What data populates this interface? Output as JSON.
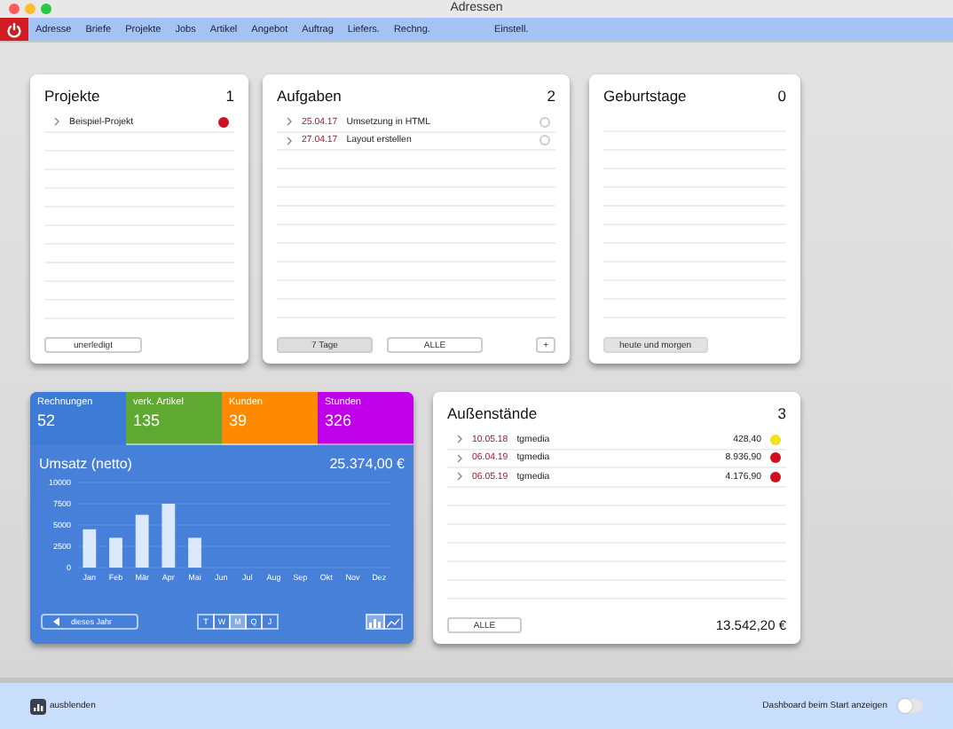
{
  "window": {
    "title": "Adressen"
  },
  "menu": {
    "main": [
      {
        "label": "Adresse"
      },
      {
        "label": "Briefe"
      },
      {
        "label": "Projekte"
      },
      {
        "label": "Jobs"
      },
      {
        "label": "Artikel"
      },
      {
        "label": "Angebot"
      },
      {
        "label": "Auftrag"
      },
      {
        "label": "Liefers."
      },
      {
        "label": "Rechng."
      }
    ],
    "extra": [
      {
        "label": "Einstell."
      }
    ]
  },
  "projects": {
    "title": "Projekte",
    "count": "1",
    "rows": [
      {
        "name": "Beispiel-Projekt",
        "color": "#d0101e"
      }
    ],
    "button": "unerledigt"
  },
  "tasks": {
    "title": "Aufgaben",
    "count": "2",
    "rows": [
      {
        "date": "25.04.17",
        "name": "Umsetzung in HTML",
        "done": false
      },
      {
        "date": "27.04.17",
        "name": "Layout erstellen",
        "done": false
      }
    ],
    "filters": [
      {
        "label": "7 Tage",
        "selected": true
      },
      {
        "label": "ALLE",
        "selected": false
      }
    ],
    "add": "+"
  },
  "birthdays": {
    "title": "Geburtstage",
    "count": "0",
    "button": "heute und morgen"
  },
  "stats": {
    "tabs": [
      {
        "label": "Rechnungen",
        "value": "52",
        "color": "#3e7bd6",
        "selected": true
      },
      {
        "label": "verk. Artikel",
        "value": "135",
        "color": "#5fa832",
        "selected": false
      },
      {
        "label": "Kunden",
        "value": "39",
        "color": "#ff8a00",
        "selected": false
      },
      {
        "label": "Stunden",
        "value": "326",
        "color": "#c000e8",
        "selected": false
      }
    ],
    "title": "Umsatz (netto)",
    "total": "25.374,00 €",
    "chart_data": {
      "type": "bar",
      "categories": [
        "Jan",
        "Feb",
        "Mär",
        "Apr",
        "Mai",
        "Jun",
        "Jul",
        "Aug",
        "Sep",
        "Okt",
        "Nov",
        "Dez"
      ],
      "grid": true,
      "series": [
        {
          "color": "#dce8fb",
          "values": [
            4500,
            3500,
            6200,
            7500,
            3500,
            null,
            null,
            null,
            null,
            null,
            null,
            null
          ]
        }
      ],
      "ylim": [
        0,
        10000
      ],
      "yticks": [
        0,
        2500,
        5000,
        7500,
        10000
      ]
    },
    "period": "dieses Jahr",
    "intervals": [
      {
        "label": "T",
        "selected": false
      },
      {
        "label": "W",
        "selected": false
      },
      {
        "label": "M",
        "selected": true
      },
      {
        "label": "Q",
        "selected": false
      },
      {
        "label": "J",
        "selected": false
      }
    ],
    "chart_types": [
      {
        "kind": "bar",
        "selected": true
      },
      {
        "kind": "line",
        "selected": false
      }
    ]
  },
  "outstanding": {
    "title": "Außenstände",
    "count": "3",
    "rows": [
      {
        "date": "10.05.18",
        "name": "tgmedia",
        "amount": "428,40",
        "color": "#f2e21a"
      },
      {
        "date": "06.04.19",
        "name": "tgmedia",
        "amount": "8.936,90",
        "color": "#d0101e"
      },
      {
        "date": "06.05.19",
        "name": "tgmedia",
        "amount": "4.176,90",
        "color": "#d0101e"
      }
    ],
    "button": "ALLE",
    "total": "13.542,20 €"
  },
  "footer": {
    "hide": "ausblenden",
    "toggle_label": "Dashboard beim Start anzeigen",
    "toggle_on": false
  }
}
